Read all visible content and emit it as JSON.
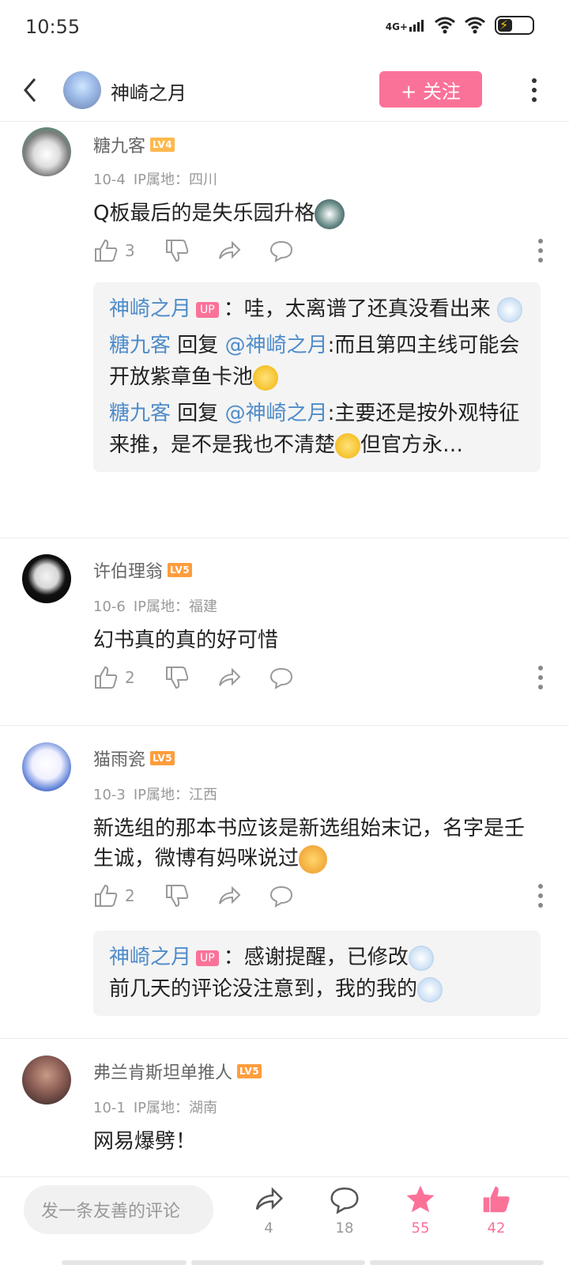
{
  "status": {
    "time": "10:55",
    "network": "4G+"
  },
  "header": {
    "title": "神崎之月",
    "follow_label": "+ 关注"
  },
  "comments": [
    {
      "user": "糖九客",
      "level": "LV4",
      "date": "10-4",
      "ip": "IP属地：四川",
      "text": "Q板最后的是失乐园升格",
      "likes": "3",
      "replies": [
        {
          "name": "神崎之月",
          "up": "UP",
          "text": "：哇，太离谱了还真没看出来"
        },
        {
          "name": "糖九客",
          "reply_word": "回复",
          "at": "@神崎之月",
          "text": ":而且第四主线可能会开放紫章鱼卡池"
        },
        {
          "name": "糖九客",
          "reply_word": "回复",
          "at": "@神崎之月",
          "text": ":主要还是按外观特征来推，是不是我也不清楚",
          "tail": "但官方永…"
        }
      ]
    },
    {
      "user": "许伯理翁",
      "level": "LV5",
      "date": "10-6",
      "ip": "IP属地：福建",
      "text": "幻书真的真的好可惜",
      "likes": "2"
    },
    {
      "user": "猫雨瓷",
      "level": "LV5",
      "date": "10-3",
      "ip": "IP属地：江西",
      "text": "新选组的那本书应该是新选组始末记，名字是壬生诚，微博有妈咪说过",
      "likes": "2",
      "replies": [
        {
          "name": "神崎之月",
          "up": "UP",
          "text": "：感谢提醒，已修改",
          "line2": "前几天的评论没注意到，我的我的"
        }
      ]
    },
    {
      "user": "弗兰肯斯坦单推人",
      "level": "LV5",
      "date": "10-1",
      "ip": "IP属地：湖南",
      "text": "网易爆劈！"
    }
  ],
  "bottom": {
    "placeholder": "发一条友善的评论",
    "share_count": "4",
    "comment_count": "18",
    "fav_count": "55",
    "like_count": "42"
  },
  "colors": {
    "accent": "#fb7299",
    "link": "#4f8cc9"
  }
}
